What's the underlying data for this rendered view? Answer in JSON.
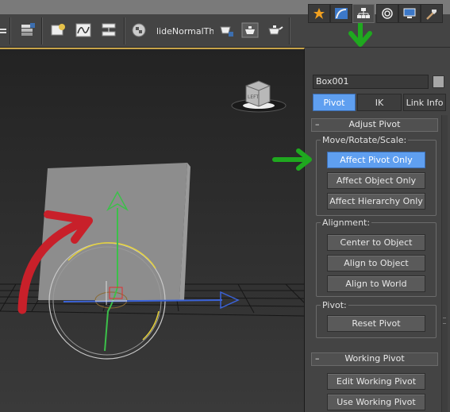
{
  "toolbar": {
    "script_text": "lideNormalThie",
    "icons": [
      "list-icon",
      "layer-manager-icon",
      "scene-explorer-icon",
      "curve-editor-icon",
      "schematic-view-icon",
      "material-editor-icon",
      "render-setup-icon",
      "rendered-frame-icon",
      "render-icon"
    ]
  },
  "viewport": {
    "object_label": "Box001",
    "viewcube_text": "LEFT"
  },
  "command_panel": {
    "tabs": [
      "create",
      "modify",
      "hierarchy",
      "motion",
      "display",
      "utilities"
    ],
    "active_tab": "hierarchy",
    "object_name": "Box001",
    "object_color": "#a7a7a7",
    "subtabs": [
      {
        "label": "Pivot",
        "active": true
      },
      {
        "label": "IK",
        "active": false
      },
      {
        "label": "Link Info",
        "active": false
      }
    ],
    "adjust_pivot": {
      "title": "Adjust Pivot",
      "collapse_symbol": "–",
      "move_group": {
        "label": "Move/Rotate/Scale:",
        "buttons": [
          "Affect Pivot Only",
          "Affect Object Only",
          "Affect Hierarchy Only"
        ],
        "active": "Affect Pivot Only"
      },
      "alignment_group": {
        "label": "Alignment:",
        "buttons": [
          "Center to Object",
          "Align to Object",
          "Align to World"
        ]
      },
      "pivot_group": {
        "label": "Pivot:",
        "buttons": [
          "Reset Pivot"
        ]
      }
    },
    "working_pivot": {
      "title": "Working Pivot",
      "collapse_symbol": "–",
      "buttons": [
        "Edit Working Pivot",
        "Use Working Pivot"
      ]
    }
  },
  "annotations": {
    "arrow_color_green": "#1fa81f",
    "arrow_color_red": "#c8202a"
  },
  "accent_color": "#5f9ff0"
}
